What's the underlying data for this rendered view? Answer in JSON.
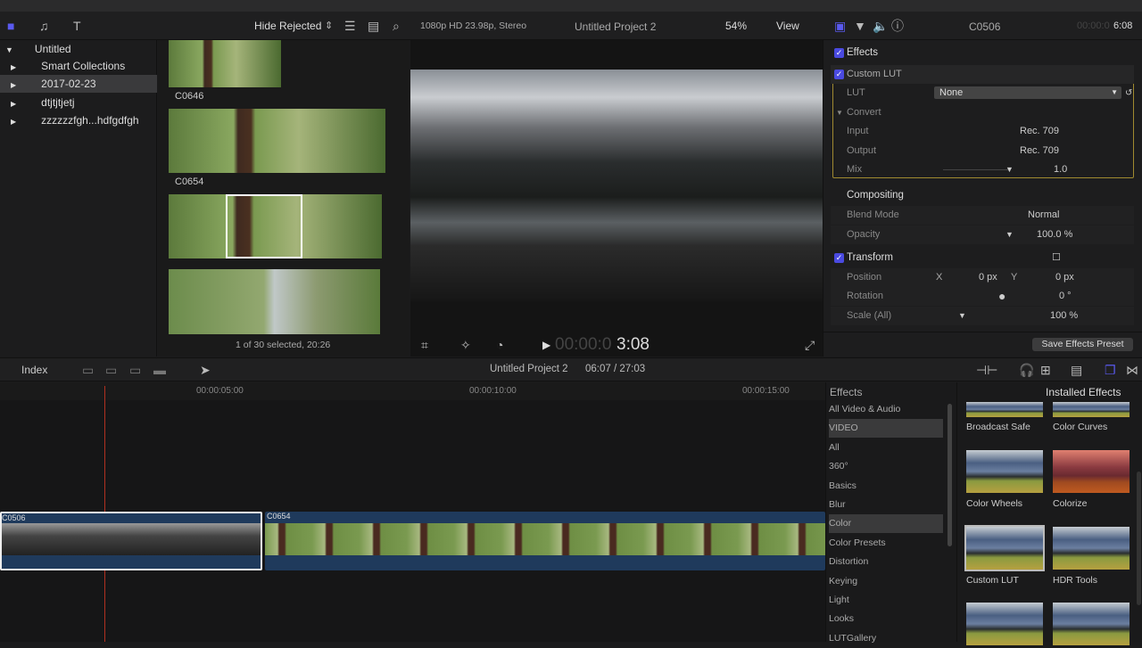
{
  "toolbar": {
    "filter": "Hide Rejected",
    "format": "1080p HD 23.98p, Stereo",
    "project": "Untitled Project 2",
    "zoom": "54%",
    "view": "View"
  },
  "library": {
    "items": [
      {
        "label": "Untitled"
      },
      {
        "label": "Smart Collections"
      },
      {
        "label": "2017-02-23"
      },
      {
        "label": "dtjtjtjetj"
      },
      {
        "label": "zzzzzzfgh...hdfgdfgh"
      }
    ]
  },
  "browser": {
    "clips": [
      "C0646",
      "C0654"
    ],
    "status": "1 of 30 selected, 20:26"
  },
  "viewer": {
    "timecode_dim": "00:00:0",
    "timecode": "3:08"
  },
  "inspector": {
    "clip": "C0506",
    "timecode_dim": "00:00:0",
    "timecode": "6:08",
    "effects": "Effects",
    "custom_lut": "Custom LUT",
    "lut_label": "LUT",
    "lut_value": "None",
    "convert": "Convert",
    "input_label": "Input",
    "input_value": "Rec. 709",
    "output_label": "Output",
    "output_value": "Rec. 709",
    "mix_label": "Mix",
    "mix_value": "1.0",
    "mix_level": 1.0,
    "compositing": "Compositing",
    "blend_label": "Blend Mode",
    "blend_value": "Normal",
    "opacity_label": "Opacity",
    "opacity_value": "100.0 %",
    "transform": "Transform",
    "position_label": "Position",
    "x_label": "X",
    "x_value": "0 px",
    "y_label": "Y",
    "y_value": "0 px",
    "rotation_label": "Rotation",
    "rotation_value": "0 °",
    "scale_label": "Scale (All)",
    "scale_value": "100 %",
    "save_preset": "Save Effects Preset"
  },
  "timeline": {
    "index": "Index",
    "project": "Untitled Project 2",
    "time": "06:07 / 27:03",
    "ticks": [
      "00:00:05:00",
      "00:00:10:00",
      "00:00:15:00"
    ],
    "clips": [
      "C0506",
      "C0654"
    ]
  },
  "effects_browser": {
    "title": "Effects",
    "source": "Installed Effects",
    "categories": [
      "All Video & Audio",
      "VIDEO",
      "All",
      "360°",
      "Basics",
      "Blur",
      "Color",
      "Color Presets",
      "Distortion",
      "Keying",
      "Light",
      "Looks",
      "LUTGallery"
    ],
    "selected_category": "Color",
    "items": [
      "Broadcast Safe",
      "Color Curves",
      "Color Wheels",
      "Colorize",
      "Custom LUT",
      "HDR Tools"
    ]
  }
}
